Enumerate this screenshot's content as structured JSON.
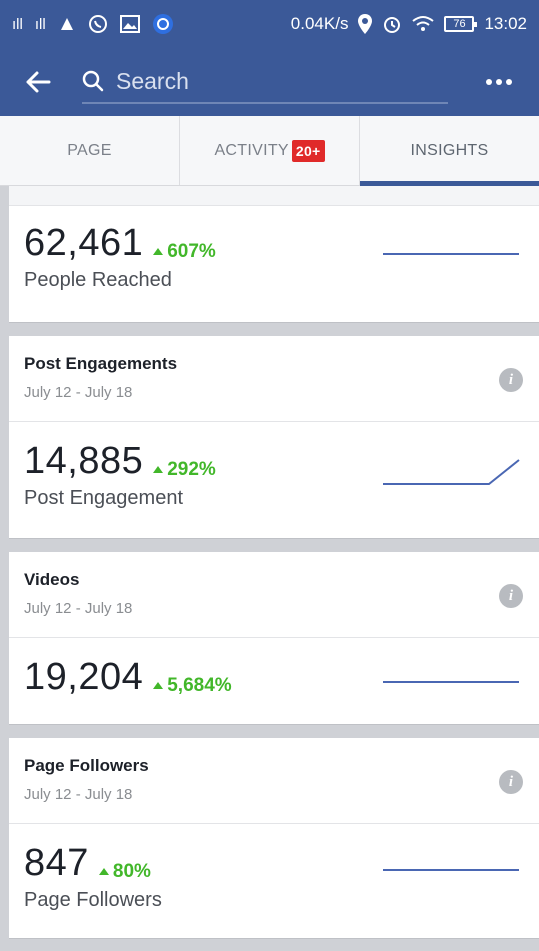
{
  "status_bar": {
    "signal1": "ıll",
    "signal2": "ıll",
    "network_speed": "0.04K/s",
    "battery": "76",
    "time": "13:02"
  },
  "app_bar": {
    "search_placeholder": "Search"
  },
  "tabs": [
    {
      "label": "PAGE"
    },
    {
      "label": "ACTIVITY",
      "badge": "20+"
    },
    {
      "label": "INSIGHTS",
      "active": true
    }
  ],
  "people_reached": {
    "value": "62,461",
    "change": "607%",
    "label": "People Reached",
    "trend": "flat"
  },
  "sections": [
    {
      "title": "Post Engagements",
      "date": "July 12 - July 18",
      "value": "14,885",
      "change": "292%",
      "label": "Post Engagement",
      "trend": "flat-then-rise"
    },
    {
      "title": "Videos",
      "date": "July 12 - July 18",
      "value": "19,204",
      "change": "5,684%",
      "label": "",
      "trend": "flat"
    },
    {
      "title": "Page Followers",
      "date": "July 12 - July 18",
      "value": "847",
      "change": "80%",
      "label": "Page Followers",
      "trend": "flat"
    }
  ],
  "colors": {
    "brand": "#3b5998",
    "positive": "#42b72a",
    "badge": "#e02a2a",
    "sparkline": "#4a67b3"
  },
  "icons": {
    "back": "arrow-left-icon",
    "search": "search-icon",
    "more": "more-dots-icon",
    "info": "info-icon"
  }
}
